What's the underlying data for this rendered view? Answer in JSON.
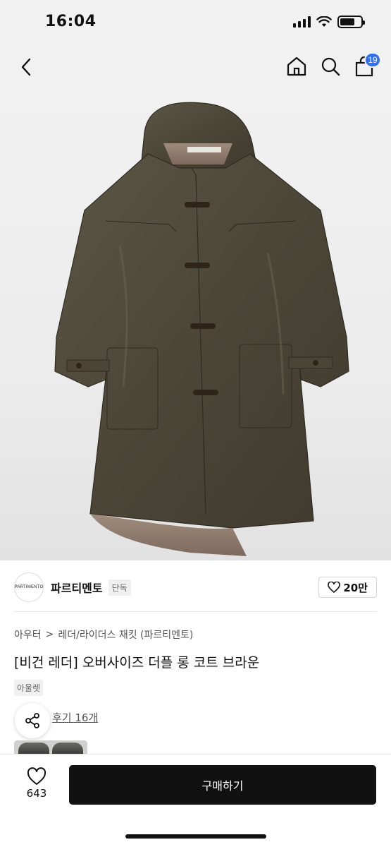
{
  "status_bar": {
    "time": "16:04"
  },
  "nav": {
    "cart_count": "19"
  },
  "product_image": {
    "description_name": "product-photo"
  },
  "brand": {
    "logo_text": "PARTIMENTO",
    "name": "파르티멘토",
    "tag": "단독",
    "likes": "20만"
  },
  "breadcrumb": {
    "category": "아우터",
    "separator": ">",
    "subcategory": "레더/라이더스 재킷 (파르티멘토)"
  },
  "product": {
    "title": "[비건 레더] 오버사이즈 더플 롱 코트 브라운",
    "outlet_tag": "아울렛",
    "reviews": "후기 16개"
  },
  "bottom_bar": {
    "wish_count": "643",
    "buy_label": "구매하기"
  },
  "colors": {
    "accent_badge": "#2f6ff5",
    "buy_button": "#111111",
    "coat": "#4e4838"
  }
}
